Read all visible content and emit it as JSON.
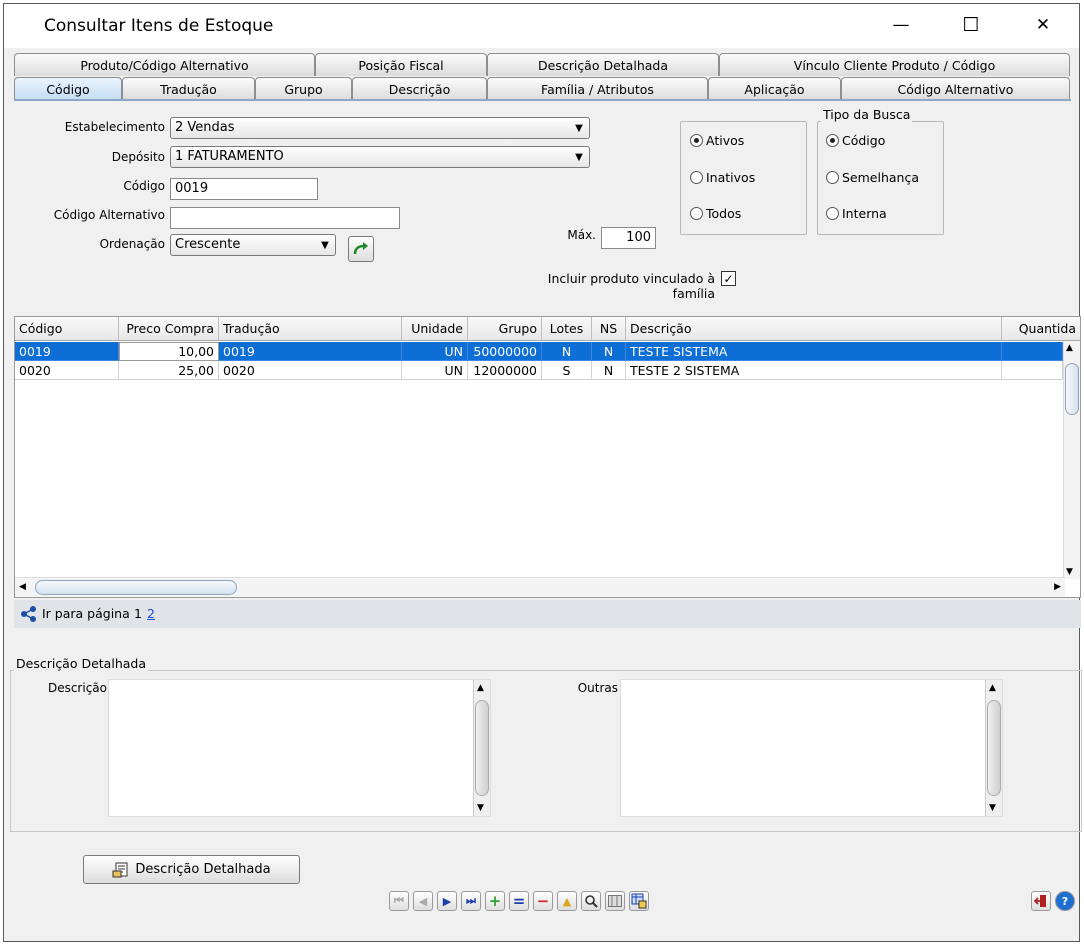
{
  "window": {
    "title": "Consultar Itens de Estoque",
    "minimize_glyph": "—",
    "maximize_glyph": "☐",
    "close_glyph": "✕"
  },
  "tabs_row1": [
    "Produto/Código Alternativo",
    "Posição Fiscal",
    "Descrição Detalhada",
    "Vínculo Cliente Produto /  Código"
  ],
  "tabs_row2": [
    "Código",
    "Tradução",
    "Grupo",
    "Descrição",
    "Família / Atributos",
    "Aplicação",
    "Código Alternativo"
  ],
  "active_tab": "Código",
  "form": {
    "estabelecimento_label": "Estabelecimento",
    "estabelecimento_value": "2 Vendas",
    "deposito_label": "Depósito",
    "deposito_value": "1 FATURAMENTO",
    "codigo_label": "Código",
    "codigo_value": "0019",
    "codigo_alt_label": "Código Alternativo",
    "codigo_alt_value": "",
    "ordenacao_label": "Ordenação",
    "ordenacao_value": "Crescente",
    "max_label": "Máx.",
    "max_value": "100",
    "incluir_label": "Incluir produto vinculado à família",
    "incluir_checked": true,
    "status_options": [
      "Ativos",
      "Inativos",
      "Todos"
    ],
    "status_selected": "Ativos",
    "tipo_busca_label": "Tipo da Busca",
    "tipo_busca_options": [
      "Código",
      "Semelhança",
      "Interna"
    ],
    "tipo_busca_selected": "Código"
  },
  "grid": {
    "columns": [
      "Código",
      "Preco Compra",
      "Tradução",
      "Unidade",
      "Grupo",
      "Lotes",
      "NS",
      "Descrição",
      "Quantida"
    ],
    "rows": [
      [
        "0019",
        "10,00",
        "0019",
        "UN",
        "50000000",
        "N",
        "N",
        "TESTE SISTEMA",
        ""
      ],
      [
        "0020",
        "25,00",
        "0020",
        "UN",
        "12000000",
        "S",
        "N",
        "TESTE 2 SISTEMA",
        ""
      ]
    ],
    "selected_row": 0
  },
  "pager": {
    "label": "Ir para página",
    "pages": [
      "1",
      "2"
    ],
    "current": "1"
  },
  "detail": {
    "legend": "Descrição Detalhada",
    "descricao_label": "Descrição",
    "outras_label": "Outras"
  },
  "buttons": {
    "descricao_detalhada": "Descrição Detalhada"
  },
  "colors": {
    "selection": "#0d6ed6",
    "add": "#2ea02e",
    "remove": "#d42a2a",
    "nav": "#1c3fae"
  }
}
